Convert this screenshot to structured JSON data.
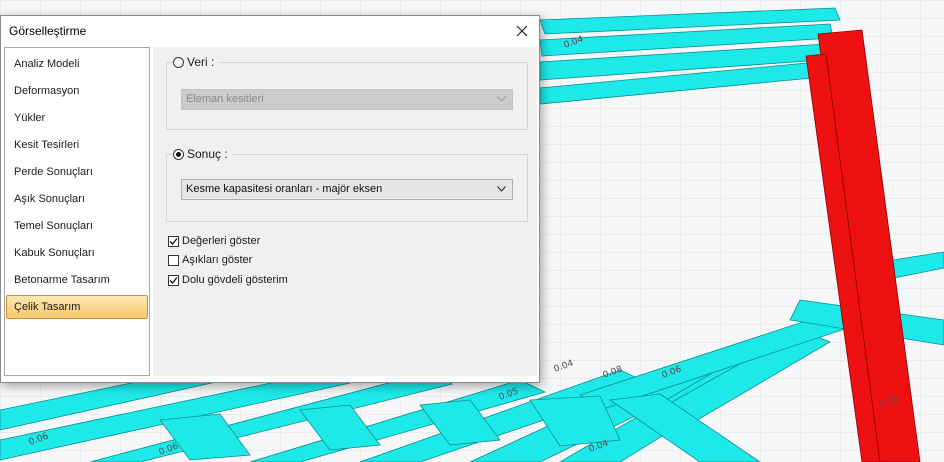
{
  "dialog": {
    "title": "Görselleştirme",
    "close_icon": "close-icon"
  },
  "sidebar": {
    "items": [
      {
        "label": "Analiz Modeli",
        "active": false
      },
      {
        "label": "Deformasyon",
        "active": false
      },
      {
        "label": "Yükler",
        "active": false
      },
      {
        "label": "Kesit Tesirleri",
        "active": false
      },
      {
        "label": "Perde Sonuçları",
        "active": false
      },
      {
        "label": "Aşık Sonuçları",
        "active": false
      },
      {
        "label": "Temel Sonuçları",
        "active": false
      },
      {
        "label": "Kabuk Sonuçları",
        "active": false
      },
      {
        "label": "Betonarme Tasarım",
        "active": false
      },
      {
        "label": "Çelik Tasarım",
        "active": true
      }
    ]
  },
  "veri": {
    "label": "Veri :",
    "selected": false,
    "dropdown_value": "Eleman kesitleri",
    "enabled": false
  },
  "sonuc": {
    "label": "Sonuç :",
    "selected": true,
    "dropdown_value": "Kesme kapasitesi oranları - majör eksen",
    "enabled": true
  },
  "options": [
    {
      "label": "Değerleri göster",
      "checked": true
    },
    {
      "label": "Aşıkları göster",
      "checked": false
    },
    {
      "label": "Dolu gövdeli gösterim",
      "checked": true
    }
  ],
  "viewport": {
    "beam_color": "#1de9e9",
    "column_color": "#ee1111",
    "value_labels": [
      "0.04",
      "0.08",
      "0.04",
      "0.06",
      "0.06",
      "0.06",
      "0.06",
      "0.04",
      "0.05"
    ]
  }
}
